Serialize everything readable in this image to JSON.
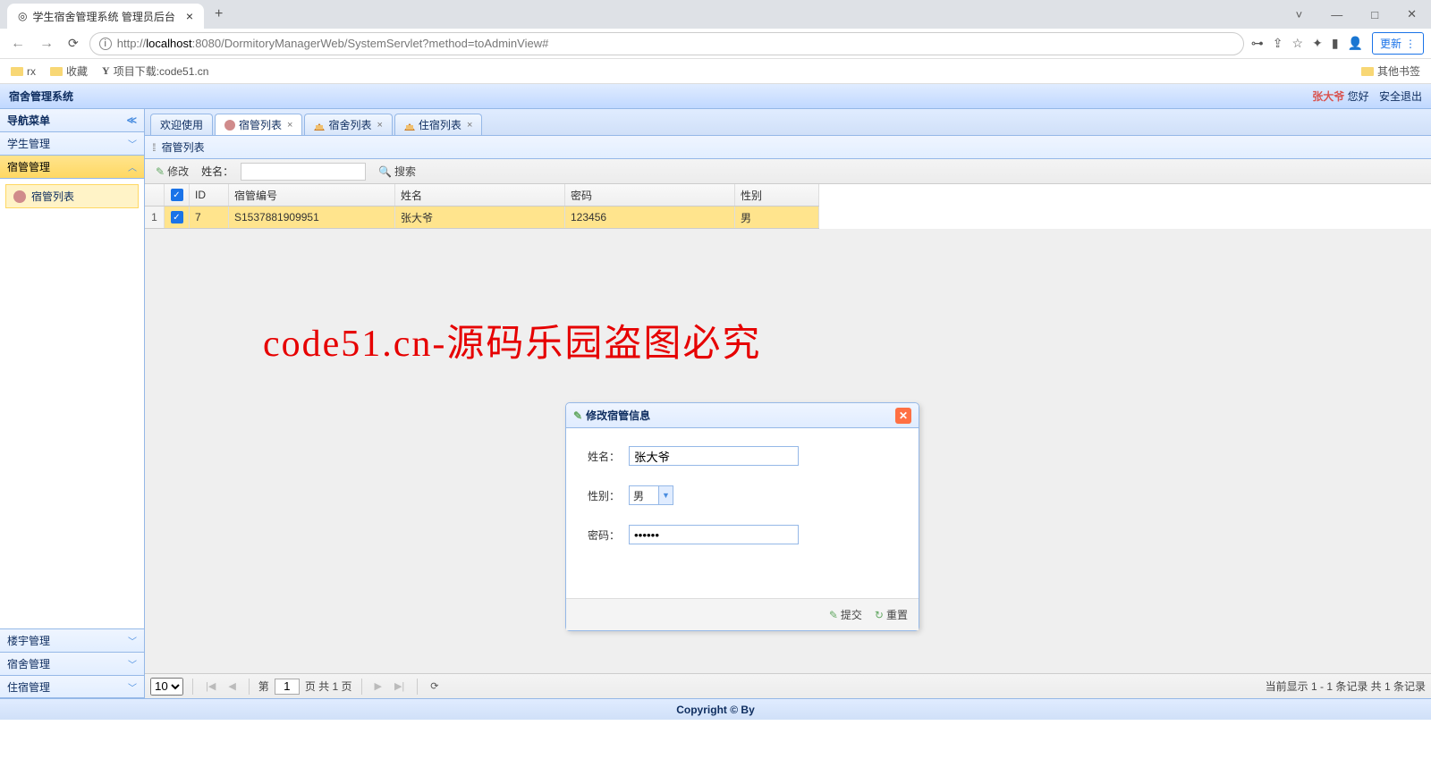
{
  "browser": {
    "tab_title": "学生宿舍管理系统 管理员后台",
    "url_host": "localhost",
    "url_prefix": "http://",
    "url_port": ":8080",
    "url_path": "/DormitoryManagerWeb/SystemServlet?method=toAdminView#",
    "update_label": "更新",
    "bookmarks": {
      "rx": "rx",
      "fav": "收藏",
      "dl": "项目下载:code51.cn",
      "other": "其他书签"
    }
  },
  "header": {
    "title": "宿舍管理系统",
    "username": "张大爷",
    "greeting": "您好",
    "logout": "安全退出"
  },
  "nav": {
    "title": "导航菜单",
    "items": [
      "学生管理",
      "宿管管理",
      "楼宇管理",
      "宿舍管理",
      "住宿管理"
    ],
    "sub_item": "宿管列表"
  },
  "tabs": [
    "欢迎使用",
    "宿管列表",
    "宿舍列表",
    "住宿列表"
  ],
  "panel": {
    "title": "宿管列表",
    "toolbar": {
      "edit": "修改",
      "name_lbl": "姓名：",
      "search": "搜索"
    },
    "columns": {
      "id": "ID",
      "sn": "宿管编号",
      "name": "姓名",
      "pw": "密码",
      "sex": "性别"
    },
    "row": {
      "rn": "1",
      "id": "7",
      "sn": "S1537881909951",
      "name": "张大爷",
      "pw": "123456",
      "sex": "男"
    },
    "pagination": {
      "page_size": "10",
      "page_lbl_pre": "第",
      "page_val": "1",
      "page_lbl_post": "页 共 1 页",
      "info": "当前显示 1 - 1 条记录 共 1 条记录"
    }
  },
  "dialog": {
    "title": "修改宿管信息",
    "name_lbl": "姓名：",
    "name_val": "张大爷",
    "sex_lbl": "性别：",
    "sex_val": "男",
    "pw_lbl": "密码：",
    "pw_val": "••••••",
    "submit": "提交",
    "reset": "重置"
  },
  "footer": "Copyright © By",
  "watermark": "code51.cn-源码乐园盗图必究"
}
